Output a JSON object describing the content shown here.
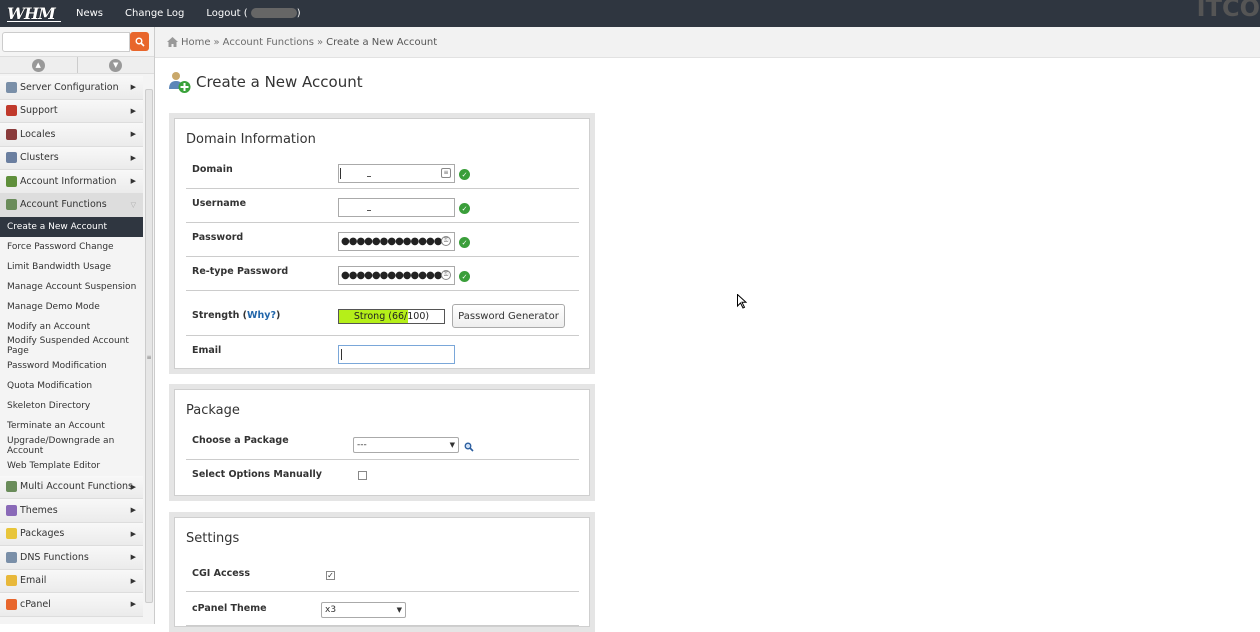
{
  "topbar": {
    "logo": "WHM",
    "links": {
      "news": "News",
      "changelog": "Change Log",
      "logout": "Logout"
    },
    "logout_username": "",
    "right_mark": "ITCO"
  },
  "sidebar": {
    "search_placeholder": "",
    "categories_top": [
      {
        "label": "Server Configuration",
        "icon_color": "#7a8fa8"
      },
      {
        "label": "Support",
        "icon_color": "#c0392b"
      },
      {
        "label": "Locales",
        "icon_color": "#8a3b3b"
      },
      {
        "label": "Clusters",
        "icon_color": "#6b7fa0"
      },
      {
        "label": "Account Information",
        "icon_color": "#5f8f3b"
      },
      {
        "label": "Account Functions",
        "icon_color": "#6a8c5a"
      }
    ],
    "subitems": [
      "Create a New Account",
      "Force Password Change",
      "Limit Bandwidth Usage",
      "Manage Account Suspension",
      "Manage Demo Mode",
      "Modify an Account",
      "Modify Suspended Account Page",
      "Password Modification",
      "Quota Modification",
      "Skeleton Directory",
      "Terminate an Account",
      "Upgrade/Downgrade an Account",
      "Web Template Editor"
    ],
    "categories_bottom": [
      {
        "label": "Multi Account Functions",
        "icon_color": "#6a8c5a"
      },
      {
        "label": "Themes",
        "icon_color": "#8a6ab8"
      },
      {
        "label": "Packages",
        "icon_color": "#e8c53a"
      },
      {
        "label": "DNS Functions",
        "icon_color": "#7a8fa8"
      },
      {
        "label": "Email",
        "icon_color": "#e8b83a"
      },
      {
        "label": "cPanel",
        "icon_color": "#e8662c"
      }
    ]
  },
  "breadcrumb": {
    "home": "Home",
    "section": "Account Functions",
    "current": "Create a New Account",
    "separator": "»"
  },
  "page": {
    "title": "Create a New Account"
  },
  "domain_info": {
    "title": "Domain Information",
    "domain_label": "Domain",
    "username_label": "Username",
    "password_label": "Password",
    "password_value": "●●●●●●●●●●●●●",
    "retype_label": "Re-type Password",
    "retype_value": "●●●●●●●●●●●●●",
    "strength_label": "Strength (",
    "strength_why": "Why?",
    "strength_close": ")",
    "strength_text": "Strong (66/100)",
    "strength_score": 66,
    "password_generator": "Password Generator",
    "email_label": "Email",
    "email_value": ""
  },
  "package": {
    "title": "Package",
    "choose_label": "Choose a Package",
    "choose_value": "---",
    "manual_label": "Select Options Manually",
    "manual_checked": false
  },
  "settings": {
    "title": "Settings",
    "cgi_label": "CGI Access",
    "cgi_checked": true,
    "theme_label": "cPanel Theme",
    "theme_value": "x3"
  }
}
